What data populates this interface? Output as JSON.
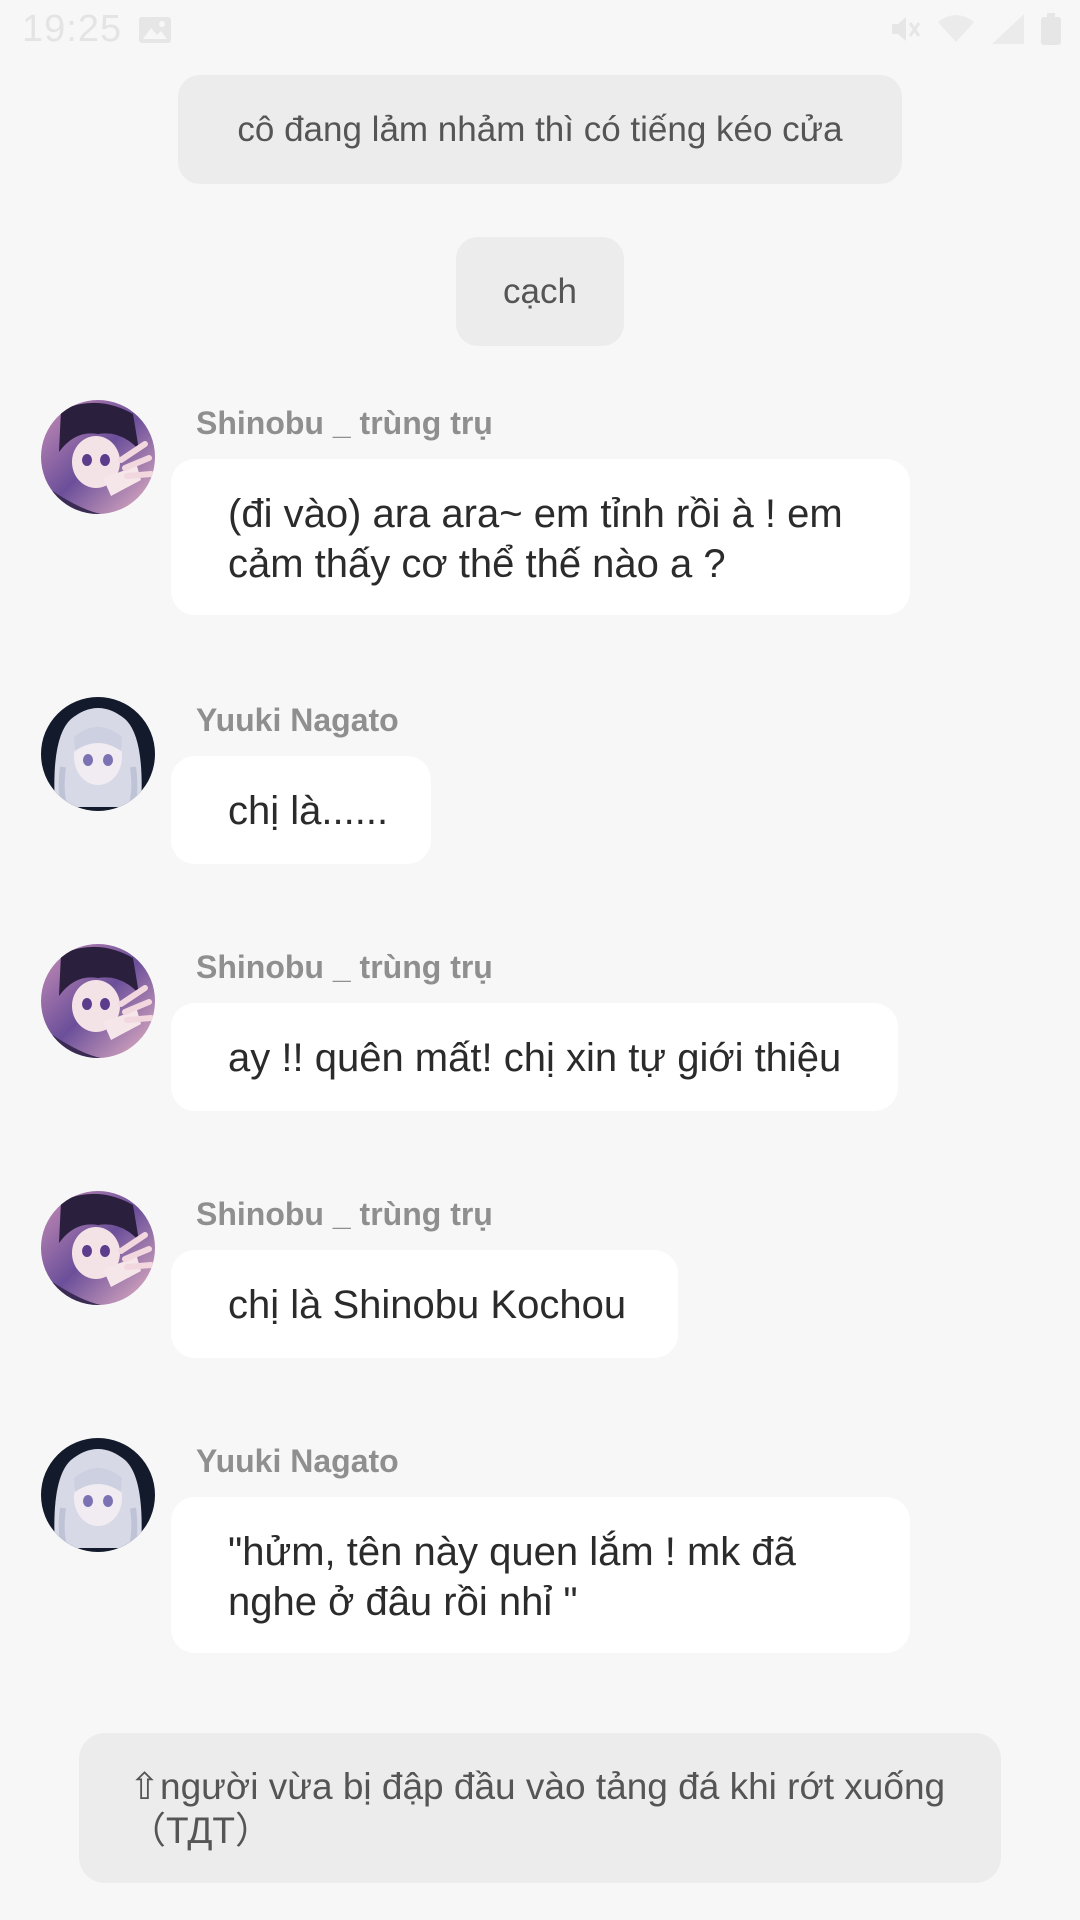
{
  "status_bar": {
    "time": "19:25",
    "icons": [
      "image-icon",
      "mute-icon",
      "wifi-icon",
      "signal-icon",
      "battery-icon"
    ]
  },
  "narrations": [
    "cô đang lảm nhảm thì có tiếng kéo cửa",
    "cạch"
  ],
  "messages": [
    {
      "sender": "Shinobu _ trùng trụ",
      "text": "(đi vào) ara ara~ em tỉnh rồi à ! em cảm thấy cơ thể thế nào a ?",
      "avatar": "shinobu-avatar"
    },
    {
      "sender": "Yuuki Nagato",
      "text": "chị là......",
      "avatar": "yuuki-avatar"
    },
    {
      "sender": "Shinobu _ trùng trụ",
      "text": "ay !! quên mất! chị xin tự giới thiệu",
      "avatar": "shinobu-avatar"
    },
    {
      "sender": "Shinobu _ trùng trụ",
      "text": "chị là Shinobu Kochou",
      "avatar": "shinobu-avatar"
    },
    {
      "sender": "Yuuki Nagato",
      "text": "\"hửm, tên này quen lắm ! mk đã nghe ở đâu rồi nhỉ \"",
      "avatar": "yuuki-avatar"
    }
  ],
  "note": {
    "text": "⇧người vừa bị đập đầu vào tảng đá khi rớt xuống（ТДТ）"
  },
  "colors": {
    "background": "#f7f7f7",
    "narration_bg": "#ececec",
    "bubble_bg": "#ffffff",
    "sender": "#8f8f8f"
  }
}
